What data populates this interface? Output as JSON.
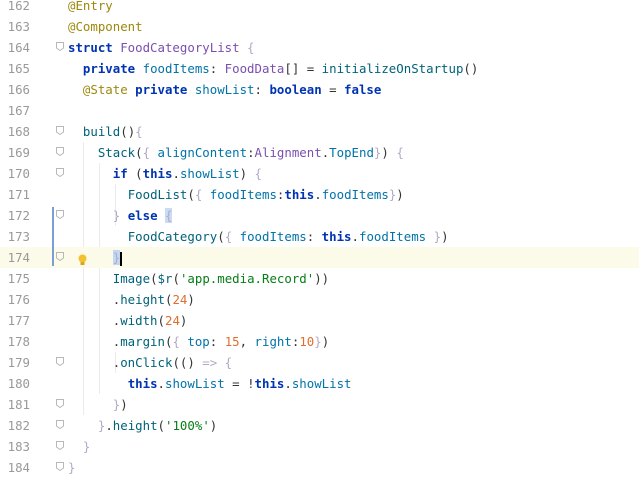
{
  "editor": {
    "language": "ArkTS",
    "current_line": 174,
    "lines": [
      {
        "n": "162",
        "t": [
          [
            "ann",
            "@Entry"
          ]
        ]
      },
      {
        "n": "163",
        "t": [
          [
            "ann",
            "@Component"
          ]
        ]
      },
      {
        "n": "164",
        "t": [
          [
            "kw",
            "struct "
          ],
          [
            "ty",
            "FoodCategoryList "
          ],
          [
            "br",
            "{"
          ]
        ]
      },
      {
        "n": "165",
        "t": [
          [
            "pn",
            "  "
          ],
          [
            "kw",
            "private "
          ],
          [
            "id",
            "foodItems"
          ],
          [
            "pn",
            ": "
          ],
          [
            "ty",
            "FoodData"
          ],
          [
            "pn",
            "[] = "
          ],
          [
            "fn",
            "initializeOnStartup"
          ],
          [
            "pn",
            "()"
          ]
        ]
      },
      {
        "n": "166",
        "t": [
          [
            "pn",
            "  "
          ],
          [
            "ann",
            "@State "
          ],
          [
            "kw",
            "private "
          ],
          [
            "id",
            "showList"
          ],
          [
            "pn",
            ": "
          ],
          [
            "bo",
            "boolean"
          ],
          [
            "pn",
            " = "
          ],
          [
            "kw",
            "false"
          ]
        ]
      },
      {
        "n": "167",
        "t": []
      },
      {
        "n": "168",
        "t": [
          [
            "pn",
            "  "
          ],
          [
            "fn",
            "build"
          ],
          [
            "pn",
            "()"
          ],
          [
            "br",
            "{"
          ]
        ]
      },
      {
        "n": "169",
        "t": [
          [
            "pn",
            "    "
          ],
          [
            "fn",
            "Stack"
          ],
          [
            "pn",
            "("
          ],
          [
            "br",
            "{ "
          ],
          [
            "id",
            "alignContent"
          ],
          [
            "pn",
            ":"
          ],
          [
            "ty",
            "Alignment"
          ],
          [
            "pn",
            "."
          ],
          [
            "id",
            "TopEnd"
          ],
          [
            "br",
            "}"
          ],
          [
            "pn",
            ") "
          ],
          [
            "br",
            "{"
          ]
        ]
      },
      {
        "n": "170",
        "t": [
          [
            "pn",
            "      "
          ],
          [
            "kw",
            "if "
          ],
          [
            "pn",
            "("
          ],
          [
            "kw",
            "this"
          ],
          [
            "pn",
            "."
          ],
          [
            "id",
            "showList"
          ],
          [
            "pn",
            ") "
          ],
          [
            "br",
            "{"
          ]
        ]
      },
      {
        "n": "171",
        "t": [
          [
            "pn",
            "        "
          ],
          [
            "fn",
            "FoodList"
          ],
          [
            "pn",
            "("
          ],
          [
            "br",
            "{ "
          ],
          [
            "id",
            "foodItems"
          ],
          [
            "pn",
            ":"
          ],
          [
            "kw",
            "this"
          ],
          [
            "pn",
            "."
          ],
          [
            "id",
            "foodItems"
          ],
          [
            "br",
            "}"
          ],
          [
            "pn",
            ")"
          ]
        ]
      },
      {
        "n": "172",
        "t": [
          [
            "pn",
            "      "
          ],
          [
            "br",
            "} "
          ],
          [
            "kw",
            "else "
          ],
          [
            "hl",
            "{"
          ]
        ]
      },
      {
        "n": "173",
        "t": [
          [
            "pn",
            "        "
          ],
          [
            "fn",
            "FoodCategory"
          ],
          [
            "pn",
            "("
          ],
          [
            "br",
            "{ "
          ],
          [
            "id",
            "foodItems"
          ],
          [
            "pn",
            ": "
          ],
          [
            "kw",
            "this"
          ],
          [
            "pn",
            "."
          ],
          [
            "id",
            "foodItems "
          ],
          [
            "br",
            "}"
          ],
          [
            "pn",
            ")"
          ]
        ]
      },
      {
        "n": "174",
        "t": [
          [
            "pn",
            "      "
          ],
          [
            "hl2",
            "}"
          ]
        ]
      },
      {
        "n": "175",
        "t": [
          [
            "pn",
            "      "
          ],
          [
            "fn",
            "Image"
          ],
          [
            "pn",
            "("
          ],
          [
            "fn",
            "$r"
          ],
          [
            "pn",
            "("
          ],
          [
            "str",
            "'app.media.Record'"
          ],
          [
            "pn",
            "))"
          ]
        ]
      },
      {
        "n": "176",
        "t": [
          [
            "pn",
            "      ."
          ],
          [
            "fn",
            "height"
          ],
          [
            "pn",
            "("
          ],
          [
            "num",
            "24"
          ],
          [
            "pn",
            ")"
          ]
        ]
      },
      {
        "n": "177",
        "t": [
          [
            "pn",
            "      ."
          ],
          [
            "fn",
            "width"
          ],
          [
            "pn",
            "("
          ],
          [
            "num",
            "24"
          ],
          [
            "pn",
            ")"
          ]
        ]
      },
      {
        "n": "178",
        "t": [
          [
            "pn",
            "      ."
          ],
          [
            "fn",
            "margin"
          ],
          [
            "pn",
            "("
          ],
          [
            "br",
            "{ "
          ],
          [
            "id",
            "top"
          ],
          [
            "pn",
            ": "
          ],
          [
            "num",
            "15"
          ],
          [
            "pn",
            ", "
          ],
          [
            "id",
            "right"
          ],
          [
            "pn",
            ":"
          ],
          [
            "num",
            "10"
          ],
          [
            "br",
            "}"
          ],
          [
            "pn",
            ")"
          ]
        ]
      },
      {
        "n": "179",
        "t": [
          [
            "pn",
            "      ."
          ],
          [
            "fn",
            "onClick"
          ],
          [
            "pn",
            "(() "
          ],
          [
            "br",
            "=> {"
          ]
        ]
      },
      {
        "n": "180",
        "t": [
          [
            "pn",
            "        "
          ],
          [
            "kw",
            "this"
          ],
          [
            "pn",
            "."
          ],
          [
            "id",
            "showList"
          ],
          [
            "pn",
            " = !"
          ],
          [
            "kw",
            "this"
          ],
          [
            "pn",
            "."
          ],
          [
            "id",
            "showList"
          ]
        ]
      },
      {
        "n": "181",
        "t": [
          [
            "pn",
            "      "
          ],
          [
            "br",
            "}"
          ],
          [
            "pn",
            ")"
          ]
        ]
      },
      {
        "n": "182",
        "t": [
          [
            "pn",
            "    "
          ],
          [
            "br",
            "}"
          ],
          [
            "pn",
            "."
          ],
          [
            "fn",
            "height"
          ],
          [
            "pn",
            "("
          ],
          [
            "str",
            "'100%'"
          ],
          [
            "pn",
            ")"
          ]
        ]
      },
      {
        "n": "183",
        "t": [
          [
            "pn",
            "  "
          ],
          [
            "br",
            "}"
          ]
        ]
      },
      {
        "n": "184",
        "t": [
          [
            "br",
            "}"
          ]
        ]
      }
    ]
  },
  "icons": {
    "intention": "lightbulb-icon",
    "fold": "fold-marker-icon"
  },
  "colors": {
    "keyword": "#0033b3",
    "annotation": "#9e880d",
    "identifier": "#0073a8",
    "function": "#00627a",
    "type": "#7b4fb0",
    "string": "#067d17",
    "number": "#e06e2c",
    "current_line_bg": "#fcfae8",
    "vcs_changed": "#7a9fd6"
  }
}
